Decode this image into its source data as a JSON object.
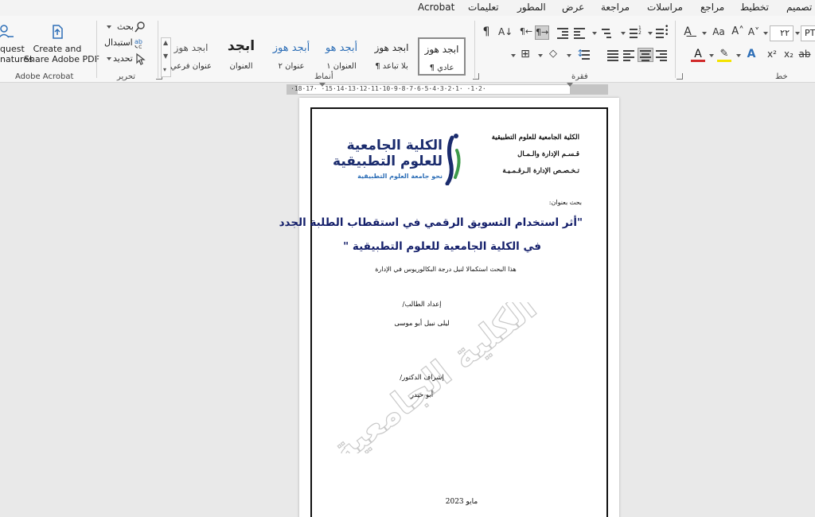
{
  "menu": {
    "tabs": [
      "تصميم",
      "تخطيط",
      "مراجع",
      "مراسلات",
      "مراجعة",
      "عرض",
      "المطور",
      "تعليمات",
      "Acrobat"
    ]
  },
  "ribbon": {
    "acrobat": {
      "create_share_line1": "Create and",
      "create_share_line2": "Share Adobe PDF",
      "request_line1": "quest",
      "request_line2": "natures",
      "group_label": "Adobe Acrobat"
    },
    "editing": {
      "find": "بحث",
      "replace": "استبدال",
      "select": "تحديد",
      "group_label": "تحرير"
    },
    "styles": {
      "group_label": "أنماط",
      "items": [
        {
          "preview": "ابجد هوز",
          "label": "¶ عادي"
        },
        {
          "preview": "ابجد هوز",
          "label": "¶ بلا تباعد"
        },
        {
          "preview": "أبجد هو",
          "label": "العنوان ١"
        },
        {
          "preview": "أبجد هوز",
          "label": "عنوان ٢"
        },
        {
          "preview": "ابجد",
          "label": "العنوان"
        },
        {
          "preview": "ابجد هوز",
          "label": "عنوان فرعي"
        }
      ]
    },
    "paragraph": {
      "group_label": "فقرة"
    },
    "font": {
      "group_label": "خط",
      "font_name": "PT",
      "font_size": "٢٢"
    }
  },
  "ruler": {
    "marks": "·18·17· ·15·14·13·12·11·10·9·8·7·6·5·4·3·2·1· ·1·2·"
  },
  "document": {
    "header_lines": [
      "الكلية الجامعية للعلوم التطبيقية",
      "قـسـم الإدارة والـمـال",
      "تـخـصـص الإدارة الـرقـمـيـة"
    ],
    "logo_text_line1": "الكلية الجامعية",
    "logo_text_line2": "للعلوم التطبيقية",
    "logo_tagline": "نحو جامعة العلوم التطبيقية",
    "research_title_label": "بحث بعنوان:",
    "title_line1": "\"أثر استخدام التسويق الرقمي في استقطاب الطلبة الجدد",
    "title_line2": "في الكلية الجامعية للعلوم التطبيقية \"",
    "subtitle": "هذا البحث استكمالا لنيل درجة البكالوريوس في الإدارة",
    "prepared_by_label": "إعداد الطالب/",
    "student_name": "ليلى نبيل أبو موسى",
    "supervisor_label": "إشراف الدكتور/",
    "supervisor_name": "أبو حيدر",
    "date": "مايو 2023",
    "watermark": "الكلية الجامعية"
  },
  "colors": {
    "title": "#15206b",
    "logo_navy": "#1a2b6d",
    "logo_green": "#3e9a4a",
    "accent_blue": "#2e6fb7",
    "font_red": "#d12a2a",
    "highlight_yellow": "#f4e300"
  }
}
